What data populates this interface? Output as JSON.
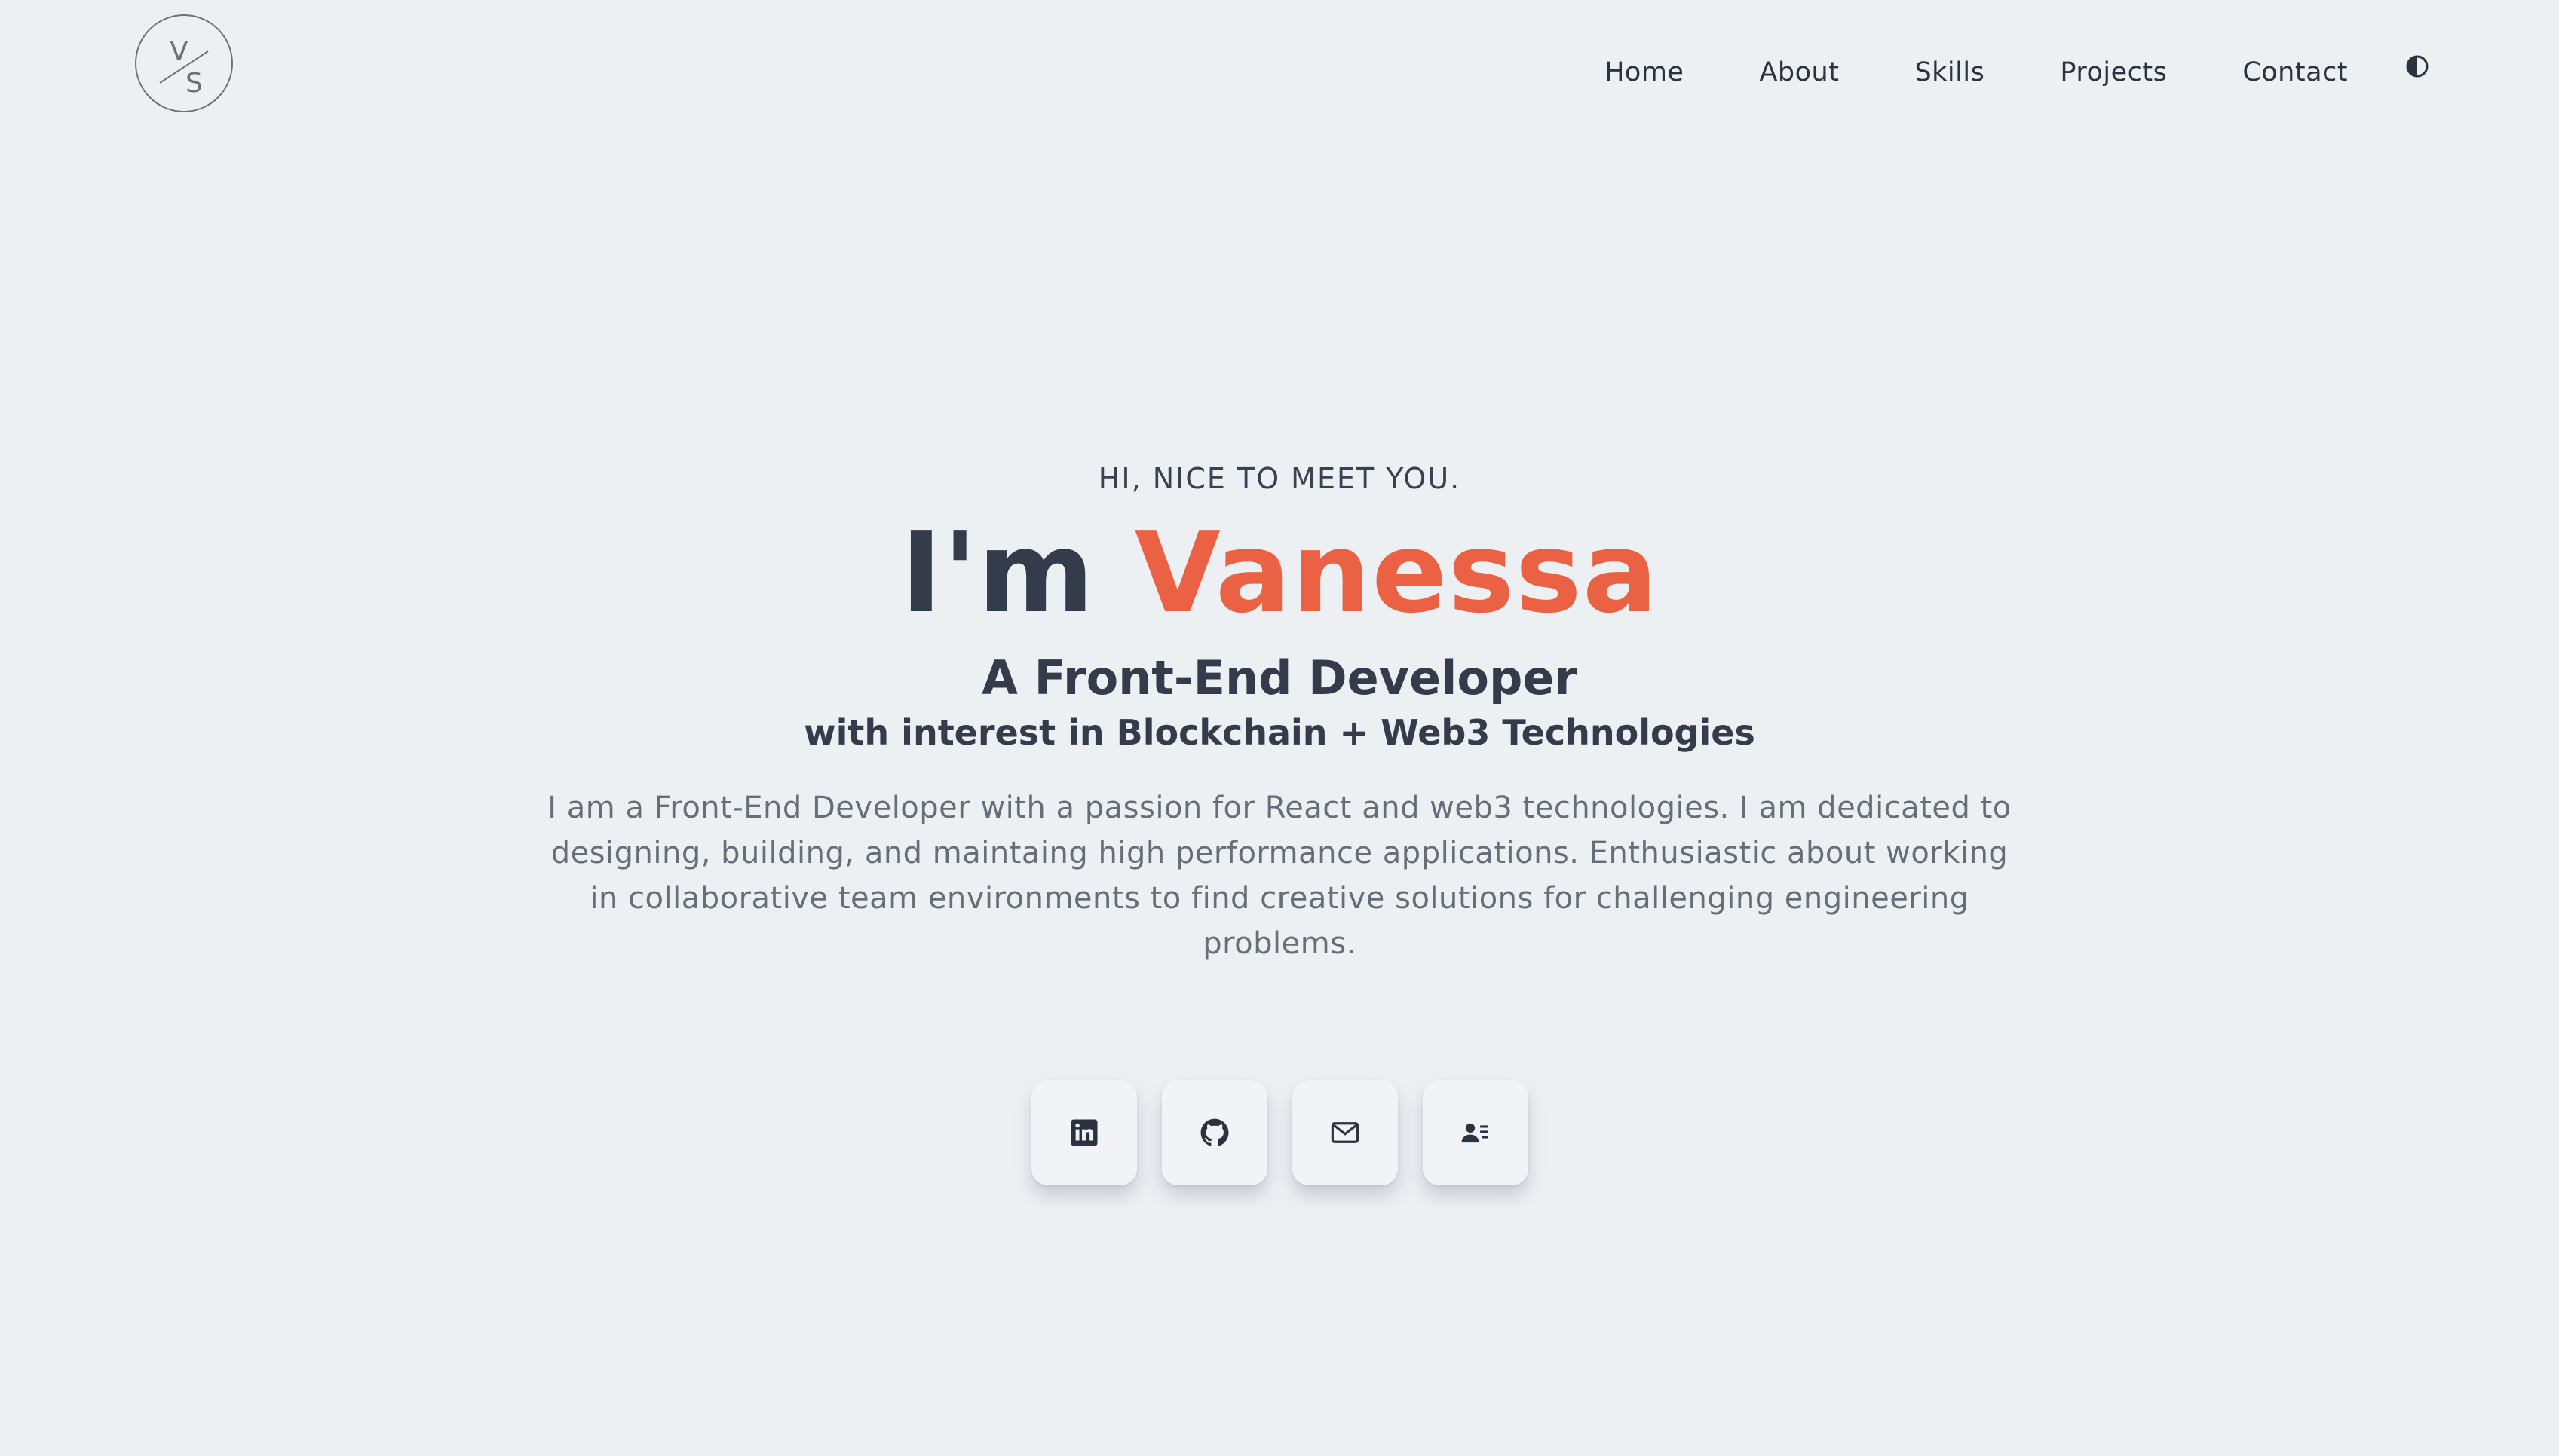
{
  "logo": {
    "letters_top": "V",
    "letters_bottom": "S"
  },
  "nav": {
    "items": [
      {
        "label": "Home"
      },
      {
        "label": "About"
      },
      {
        "label": "Skills"
      },
      {
        "label": "Projects"
      },
      {
        "label": "Contact"
      }
    ],
    "theme_toggle_icon": "half-circle-contrast-icon"
  },
  "hero": {
    "greeting": "HI, NICE TO MEET YOU.",
    "headline_prefix": "I'm",
    "headline_name": "Vanessa",
    "role": "A Front-End Developer",
    "interest": "with interest in Blockchain + Web3 Technologies",
    "bio": "I am a Front-End Developer with a passion for React and web3 technologies. I am dedicated to designing, building, and maintaing high performance applications. Enthusiastic about working in collaborative team environments to find creative solutions for challenging engineering problems."
  },
  "socials": [
    {
      "icon": "linkedin-icon"
    },
    {
      "icon": "github-icon"
    },
    {
      "icon": "mail-icon"
    },
    {
      "icon": "resume-contact-icon"
    }
  ],
  "colors": {
    "background": "#edf0f3",
    "text_dark": "#343c4b",
    "accent": "#ea6144",
    "body_text": "#686e79"
  }
}
